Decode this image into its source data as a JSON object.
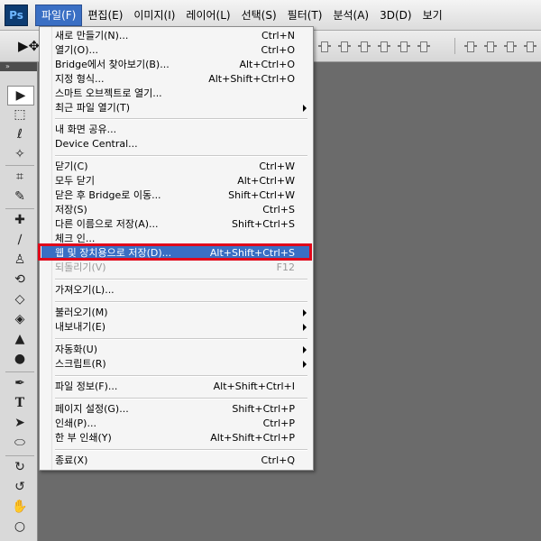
{
  "app": {
    "logo": "Ps"
  },
  "menubar": {
    "items": [
      {
        "label": "파일(F)",
        "active": true
      },
      {
        "label": "편집(E)"
      },
      {
        "label": "이미지(I)"
      },
      {
        "label": "레이어(L)"
      },
      {
        "label": "선택(S)"
      },
      {
        "label": "필터(T)"
      },
      {
        "label": "분석(A)"
      },
      {
        "label": "3D(D)"
      },
      {
        "label": "보기"
      }
    ]
  },
  "file_menu": {
    "items": [
      {
        "label": "새로 만들기(N)...",
        "shortcut": "Ctrl+N"
      },
      {
        "label": "열기(O)...",
        "shortcut": "Ctrl+O"
      },
      {
        "label": "Bridge에서 찾아보기(B)...",
        "shortcut": "Alt+Ctrl+O"
      },
      {
        "label": "지정 형식...",
        "shortcut": "Alt+Shift+Ctrl+O"
      },
      {
        "label": "스마트 오브젝트로 열기..."
      },
      {
        "label": "최근 파일 열기(T)",
        "submenu": true
      },
      {
        "label": "내 화면 공유..."
      },
      {
        "label": "Device Central..."
      },
      {
        "label": "닫기(C)",
        "shortcut": "Ctrl+W"
      },
      {
        "label": "모두 닫기",
        "shortcut": "Alt+Ctrl+W"
      },
      {
        "label": "닫은 후 Bridge로 이동...",
        "shortcut": "Shift+Ctrl+W"
      },
      {
        "label": "저장(S)",
        "shortcut": "Ctrl+S"
      },
      {
        "label": "다른 이름으로 저장(A)...",
        "shortcut": "Shift+Ctrl+S"
      },
      {
        "label": "체크 인..."
      },
      {
        "label": "웹 및 장치용으로 저장(D)...",
        "shortcut": "Alt+Shift+Ctrl+S",
        "highlighted": true
      },
      {
        "label": "되돌리기(V)",
        "shortcut": "F12",
        "disabled": true
      },
      {
        "label": "가져오기(L)..."
      },
      {
        "label": "불러오기(M)",
        "submenu": true
      },
      {
        "label": "내보내기(E)",
        "submenu": true
      },
      {
        "label": "자동화(U)",
        "submenu": true
      },
      {
        "label": "스크립트(R)",
        "submenu": true
      },
      {
        "label": "파일 정보(F)...",
        "shortcut": "Alt+Shift+Ctrl+I"
      },
      {
        "label": "페이지 설정(G)...",
        "shortcut": "Shift+Ctrl+P"
      },
      {
        "label": "인쇄(P)...",
        "shortcut": "Ctrl+P"
      },
      {
        "label": "한 부 인쇄(Y)",
        "shortcut": "Alt+Shift+Ctrl+P"
      },
      {
        "label": "종료(X)",
        "shortcut": "Ctrl+Q"
      }
    ]
  },
  "toolbox": {
    "tools": [
      "move-tool",
      "marquee-tool",
      "lasso-tool",
      "magic-wand-tool",
      "crop-tool",
      "eyedropper-tool",
      "healing-brush-tool",
      "brush-tool",
      "clone-stamp-tool",
      "history-brush-tool",
      "eraser-tool",
      "paint-bucket-tool",
      "blur-tool",
      "dodge-tool",
      "pen-tool",
      "type-tool",
      "path-selection-tool",
      "shape-tool",
      "3d-rotate-tool",
      "3d-orbit-tool",
      "hand-tool",
      "zoom-tool"
    ]
  },
  "colors": {
    "highlight": "#3a6fc4",
    "callout": "#e1061a",
    "workspace": "#6b6b6b"
  }
}
